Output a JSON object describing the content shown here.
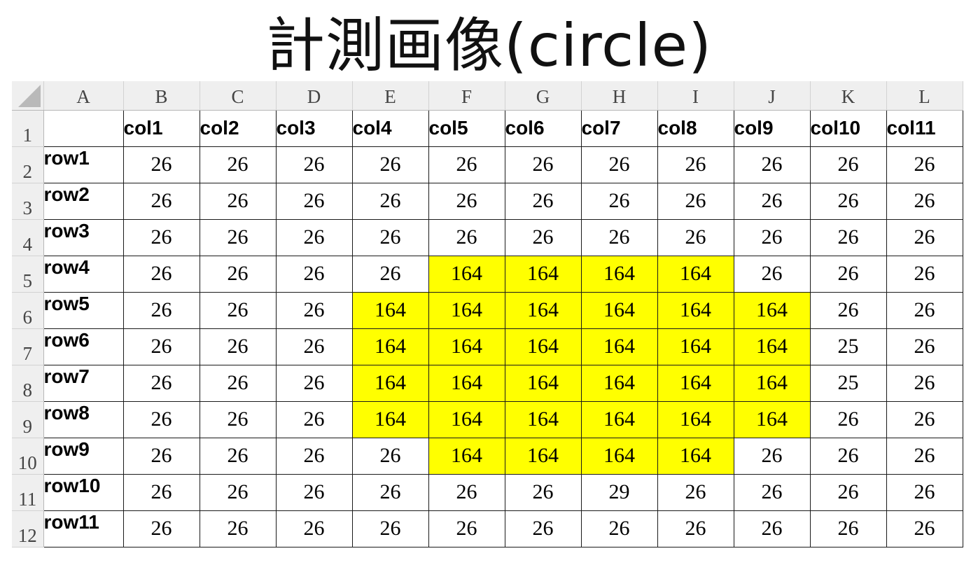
{
  "title": "計測画像(circle)",
  "highlight_color": "#ffff00",
  "column_letters": [
    "A",
    "B",
    "C",
    "D",
    "E",
    "F",
    "G",
    "H",
    "I",
    "J",
    "K",
    "L"
  ],
  "row_numbers": [
    "1",
    "2",
    "3",
    "4",
    "5",
    "6",
    "7",
    "8",
    "9",
    "10",
    "11",
    "12"
  ],
  "header_row": [
    "",
    "col1",
    "col2",
    "col3",
    "col4",
    "col5",
    "col6",
    "col7",
    "col8",
    "col9",
    "col10",
    "col11"
  ],
  "rows": [
    {
      "name": "row1",
      "values": [
        "26",
        "26",
        "26",
        "26",
        "26",
        "26",
        "26",
        "26",
        "26",
        "26",
        "26"
      ],
      "highlighted": [
        false,
        false,
        false,
        false,
        false,
        false,
        false,
        false,
        false,
        false,
        false
      ]
    },
    {
      "name": "row2",
      "values": [
        "26",
        "26",
        "26",
        "26",
        "26",
        "26",
        "26",
        "26",
        "26",
        "26",
        "26"
      ],
      "highlighted": [
        false,
        false,
        false,
        false,
        false,
        false,
        false,
        false,
        false,
        false,
        false
      ]
    },
    {
      "name": "row3",
      "values": [
        "26",
        "26",
        "26",
        "26",
        "26",
        "26",
        "26",
        "26",
        "26",
        "26",
        "26"
      ],
      "highlighted": [
        false,
        false,
        false,
        false,
        false,
        false,
        false,
        false,
        false,
        false,
        false
      ]
    },
    {
      "name": "row4",
      "values": [
        "26",
        "26",
        "26",
        "26",
        "164",
        "164",
        "164",
        "164",
        "26",
        "26",
        "26"
      ],
      "highlighted": [
        false,
        false,
        false,
        false,
        true,
        true,
        true,
        true,
        false,
        false,
        false
      ]
    },
    {
      "name": "row5",
      "values": [
        "26",
        "26",
        "26",
        "164",
        "164",
        "164",
        "164",
        "164",
        "164",
        "26",
        "26"
      ],
      "highlighted": [
        false,
        false,
        false,
        true,
        true,
        true,
        true,
        true,
        true,
        false,
        false
      ]
    },
    {
      "name": "row6",
      "values": [
        "26",
        "26",
        "26",
        "164",
        "164",
        "164",
        "164",
        "164",
        "164",
        "25",
        "26"
      ],
      "highlighted": [
        false,
        false,
        false,
        true,
        true,
        true,
        true,
        true,
        true,
        false,
        false
      ]
    },
    {
      "name": "row7",
      "values": [
        "26",
        "26",
        "26",
        "164",
        "164",
        "164",
        "164",
        "164",
        "164",
        "25",
        "26"
      ],
      "highlighted": [
        false,
        false,
        false,
        true,
        true,
        true,
        true,
        true,
        true,
        false,
        false
      ]
    },
    {
      "name": "row8",
      "values": [
        "26",
        "26",
        "26",
        "164",
        "164",
        "164",
        "164",
        "164",
        "164",
        "26",
        "26"
      ],
      "highlighted": [
        false,
        false,
        false,
        true,
        true,
        true,
        true,
        true,
        true,
        false,
        false
      ]
    },
    {
      "name": "row9",
      "values": [
        "26",
        "26",
        "26",
        "26",
        "164",
        "164",
        "164",
        "164",
        "26",
        "26",
        "26"
      ],
      "highlighted": [
        false,
        false,
        false,
        false,
        true,
        true,
        true,
        true,
        false,
        false,
        false
      ]
    },
    {
      "name": "row10",
      "values": [
        "26",
        "26",
        "26",
        "26",
        "26",
        "26",
        "29",
        "26",
        "26",
        "26",
        "26"
      ],
      "highlighted": [
        false,
        false,
        false,
        false,
        false,
        false,
        false,
        false,
        false,
        false,
        false
      ]
    },
    {
      "name": "row11",
      "values": [
        "26",
        "26",
        "26",
        "26",
        "26",
        "26",
        "26",
        "26",
        "26",
        "26",
        "26"
      ],
      "highlighted": [
        false,
        false,
        false,
        false,
        false,
        false,
        false,
        false,
        false,
        false,
        false
      ]
    }
  ]
}
